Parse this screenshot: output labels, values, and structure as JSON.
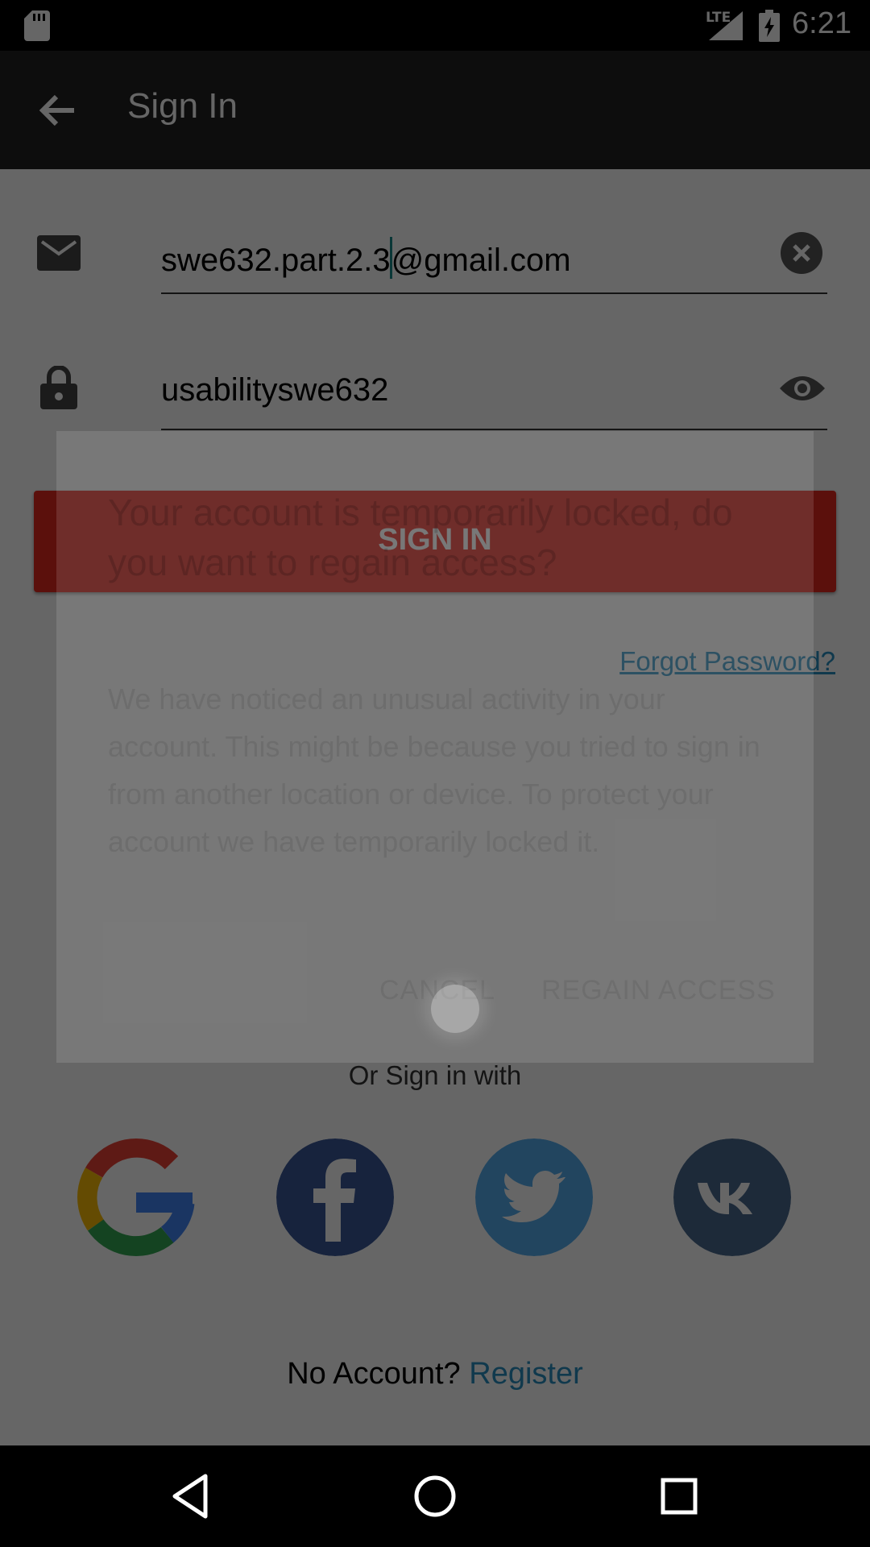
{
  "status_bar": {
    "time": "6:21",
    "network": "LTE",
    "icons": [
      "sd-card-icon",
      "lte-signal-icon",
      "battery-charging-icon"
    ]
  },
  "app_bar": {
    "title": "Sign In",
    "back_icon": "arrow-back-icon"
  },
  "form": {
    "email": {
      "icon": "mail-icon",
      "value_before_cursor": "swe632.part.2.3",
      "value_after_cursor": "@gmail.com",
      "clear_icon": "clear-circle-icon"
    },
    "password": {
      "icon": "lock-icon",
      "value": "usabilityswe632",
      "toggle_icon": "eye-icon"
    },
    "sign_in_label": "SIGN IN",
    "forgot_password": "Forgot Password?",
    "or_sign_in_with": "Or Sign in with",
    "social": [
      "google-icon",
      "facebook-icon",
      "twitter-icon",
      "vk-icon"
    ],
    "no_account": "No Account?",
    "register": "Register"
  },
  "dialog": {
    "title": "Your account is temporarily locked, do you want to regain access?",
    "message": "We have noticed an unusual activity in your account. This might be because you tried to sign in from another location or device. To protect your account we have temporarily locked it.",
    "cancel": "CANCEL",
    "regain_access": "REGAIN ACCESS"
  },
  "nav_bar": {
    "icons": [
      "back-triangle-icon",
      "home-circle-icon",
      "recents-square-icon"
    ]
  },
  "colors": {
    "accent_red": "#e3281f",
    "link_blue": "#2a8fc0",
    "app_bar": "#212121",
    "facebook": "#3b5998",
    "twitter": "#55acee",
    "vk": "#4a6a8f"
  }
}
